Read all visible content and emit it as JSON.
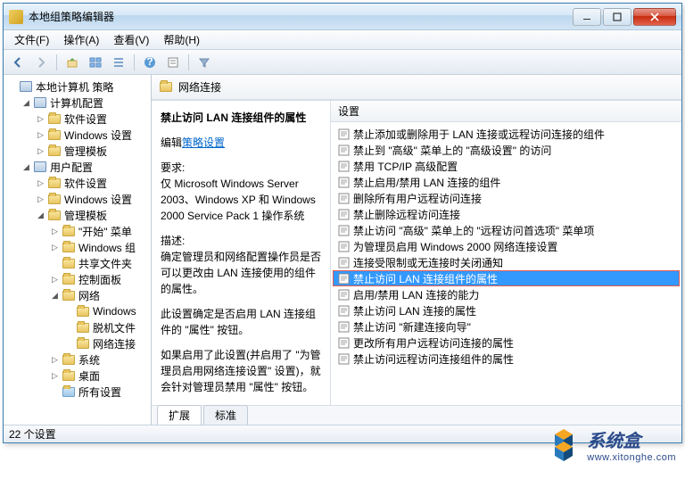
{
  "window": {
    "title": "本地组策略编辑器"
  },
  "menu": {
    "file": "文件(F)",
    "action": "操作(A)",
    "view": "查看(V)",
    "help": "帮助(H)"
  },
  "tree": {
    "root": "本地计算机 策略",
    "computer_config": "计算机配置",
    "software_settings": "软件设置",
    "windows_settings": "Windows 设置",
    "admin_templates": "管理模板",
    "user_config": "用户配置",
    "start_menu": "\"开始\" 菜单",
    "windows_group": "Windows 组",
    "shared_folders": "共享文件夹",
    "control_panel": "控制面板",
    "network": "网络",
    "windows_sub": "Windows",
    "offline_files": "脱机文件",
    "network_connections": "网络连接",
    "system": "系统",
    "desktop": "桌面",
    "all_settings": "所有设置"
  },
  "header": {
    "title": "网络连接"
  },
  "details": {
    "title": "禁止访问 LAN 连接组件的属性",
    "edit_link_prefix": "编辑",
    "edit_link": "策略设置",
    "req_label": "要求:",
    "req_text": "仅 Microsoft Windows Server 2003、Windows XP 和 Windows 2000 Service Pack 1 操作系统",
    "desc_label": "描述:",
    "desc1": "确定管理员和网络配置操作员是否可以更改由 LAN 连接使用的组件的属性。",
    "desc2": "此设置确定是否启用 LAN 连接组件的 \"属性\" 按钮。",
    "desc3": "如果启用了此设置(并启用了 \"为管理员启用网络连接设置\" 设置)，就会针对管理员禁用 \"属性\" 按钮。"
  },
  "list_header": "设置",
  "settings": [
    "禁止添加或删除用于 LAN 连接或远程访问连接的组件",
    "禁止到 \"高级\" 菜单上的 \"高级设置\" 的访问",
    "禁用 TCP/IP 高级配置",
    "禁止启用/禁用 LAN 连接的组件",
    "删除所有用户远程访问连接",
    "禁止删除远程访问连接",
    "禁止访问 \"高级\" 菜单上的 \"远程访问首选项\" 菜单项",
    "为管理员启用 Windows 2000 网络连接设置",
    "连接受限制或无连接时关闭通知",
    "禁止访问 LAN 连接组件的属性",
    "启用/禁用 LAN 连接的能力",
    "禁止访问 LAN 连接的属性",
    "禁止访问 \"新建连接向导\"",
    "更改所有用户远程访问连接的属性",
    "禁止访问远程访问连接组件的属性"
  ],
  "selected_index": 9,
  "tabs": {
    "ext": "扩展",
    "std": "标准"
  },
  "status": "22 个设置",
  "watermark": {
    "brand": "系统盒",
    "url": "www.xitonghe.com"
  }
}
